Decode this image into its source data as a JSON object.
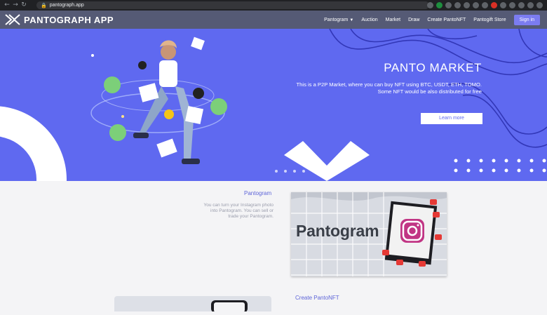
{
  "browser": {
    "url": "pantograph.app",
    "back_icon": "arrow-left-icon",
    "forward_icon": "arrow-right-icon",
    "reload_icon": "reload-icon",
    "lock_icon": "lock-icon"
  },
  "navbar": {
    "logo_text": "PANTOGRAPH APP",
    "links": {
      "pantogram": "Pantogram",
      "auction": "Auction",
      "market": "Market",
      "draw": "Draw",
      "create": "Create PantoNFT",
      "gift": "Pantogift Store"
    },
    "signin": "Sign in"
  },
  "hero": {
    "title": "PANTO MARKET",
    "line1": "This is a P2P Market, where you can buy NFT using BTC, USDT, ETH, TOMO.",
    "line2": "Some NFT would be also distributed for free",
    "button": "Learn more",
    "bg_color": "#5f69f0"
  },
  "pantogram": {
    "title": "Pantogram",
    "desc_line1": "You can turn your Instagram photo",
    "desc_line2": "into Pantogram. You can sell or",
    "desc_line3": "trade your Pantogram.",
    "image_word": "Pantogram",
    "instagram_icon": "instagram-icon"
  },
  "create": {
    "title": "Create PantoNFT"
  },
  "colors": {
    "nav_bg": "#555a75",
    "accent": "#5d64d8",
    "signin_bg": "#7b7cf1"
  }
}
